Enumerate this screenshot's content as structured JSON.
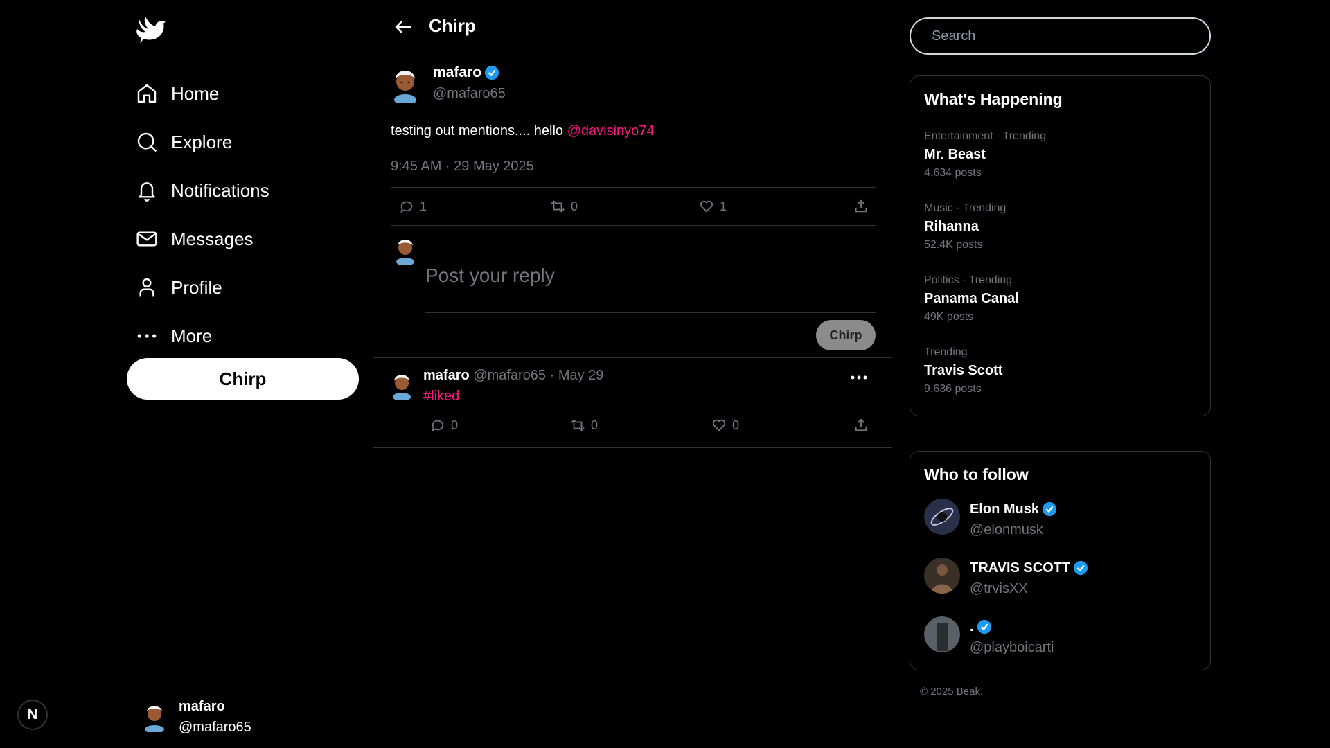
{
  "sidebar": {
    "nav": [
      {
        "label": "Home",
        "icon": "home-icon"
      },
      {
        "label": "Explore",
        "icon": "search-icon"
      },
      {
        "label": "Notifications",
        "icon": "bell-icon"
      },
      {
        "label": "Messages",
        "icon": "mail-icon"
      },
      {
        "label": "Profile",
        "icon": "user-icon"
      },
      {
        "label": "More",
        "icon": "more-dots-icon"
      }
    ],
    "chirp_button": "Chirp",
    "user": {
      "name": "mafaro",
      "handle": "@mafaro65"
    },
    "dev_badge": "N"
  },
  "header": {
    "title": "Chirp"
  },
  "post": {
    "name": "mafaro",
    "handle": "@mafaro65",
    "text": "testing out mentions.... hello ",
    "mention": "@davisinyo74",
    "time": "9:45 AM · 29 May 2025",
    "replies": "1",
    "rechirps": "0",
    "likes": "1"
  },
  "composer": {
    "placeholder": "Post your reply",
    "button": "Chirp"
  },
  "reply": {
    "name": "mafaro",
    "meta": " @mafaro65 · May 29",
    "tag": "#liked",
    "replies": "0",
    "rechirps": "0",
    "likes": "0"
  },
  "search": {
    "placeholder": "Search"
  },
  "trends": {
    "title": "What's Happening",
    "items": [
      {
        "category": "Entertainment · Trending",
        "name": "Mr. Beast",
        "count": "4,634 posts"
      },
      {
        "category": "Music · Trending",
        "name": "Rihanna",
        "count": "52.4K posts"
      },
      {
        "category": "Politics · Trending",
        "name": "Panama Canal",
        "count": "49K posts"
      },
      {
        "category": "Trending",
        "name": "Travis Scott",
        "count": "9,636 posts"
      }
    ]
  },
  "follow": {
    "title": "Who to follow",
    "users": [
      {
        "name": "Elon Musk",
        "handle": "@elonmusk"
      },
      {
        "name": "TRAVIS SCOTT",
        "handle": "@trvisXX"
      },
      {
        "name": ".",
        "handle": "@playboicarti"
      }
    ]
  },
  "footer": {
    "copyright": "© 2025 Beak."
  },
  "colors": {
    "accent": "#f91880",
    "verified": "#1d9bf0",
    "muted": "#71767b",
    "border": "#2f3336"
  }
}
